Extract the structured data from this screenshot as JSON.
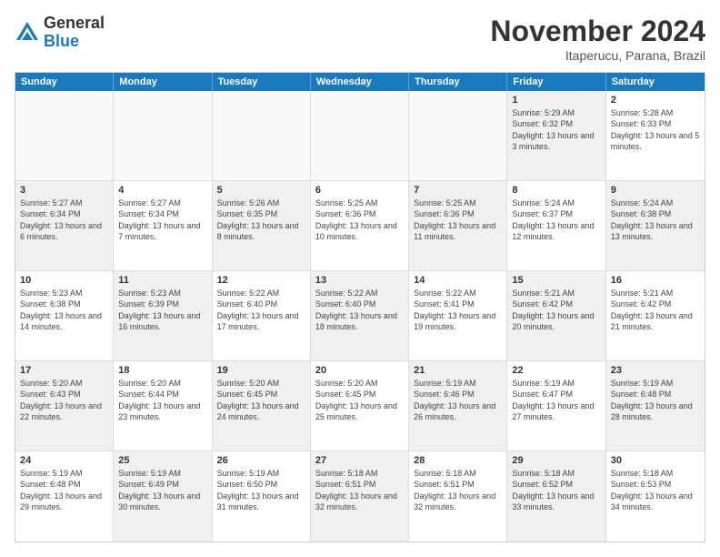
{
  "header": {
    "logo_general": "General",
    "logo_blue": "Blue",
    "month_title": "November 2024",
    "location": "Itaperucu, Parana, Brazil"
  },
  "calendar": {
    "days_of_week": [
      "Sunday",
      "Monday",
      "Tuesday",
      "Wednesday",
      "Thursday",
      "Friday",
      "Saturday"
    ],
    "rows": [
      [
        {
          "day": "",
          "info": "",
          "shaded": false,
          "empty": true
        },
        {
          "day": "",
          "info": "",
          "shaded": false,
          "empty": true
        },
        {
          "day": "",
          "info": "",
          "shaded": false,
          "empty": true
        },
        {
          "day": "",
          "info": "",
          "shaded": false,
          "empty": true
        },
        {
          "day": "",
          "info": "",
          "shaded": false,
          "empty": true
        },
        {
          "day": "1",
          "info": "Sunrise: 5:29 AM\nSunset: 6:32 PM\nDaylight: 13 hours and 3 minutes.",
          "shaded": true,
          "empty": false
        },
        {
          "day": "2",
          "info": "Sunrise: 5:28 AM\nSunset: 6:33 PM\nDaylight: 13 hours and 5 minutes.",
          "shaded": false,
          "empty": false
        }
      ],
      [
        {
          "day": "3",
          "info": "Sunrise: 5:27 AM\nSunset: 6:34 PM\nDaylight: 13 hours and 6 minutes.",
          "shaded": true,
          "empty": false
        },
        {
          "day": "4",
          "info": "Sunrise: 5:27 AM\nSunset: 6:34 PM\nDaylight: 13 hours and 7 minutes.",
          "shaded": false,
          "empty": false
        },
        {
          "day": "5",
          "info": "Sunrise: 5:26 AM\nSunset: 6:35 PM\nDaylight: 13 hours and 8 minutes.",
          "shaded": true,
          "empty": false
        },
        {
          "day": "6",
          "info": "Sunrise: 5:25 AM\nSunset: 6:36 PM\nDaylight: 13 hours and 10 minutes.",
          "shaded": false,
          "empty": false
        },
        {
          "day": "7",
          "info": "Sunrise: 5:25 AM\nSunset: 6:36 PM\nDaylight: 13 hours and 11 minutes.",
          "shaded": true,
          "empty": false
        },
        {
          "day": "8",
          "info": "Sunrise: 5:24 AM\nSunset: 6:37 PM\nDaylight: 13 hours and 12 minutes.",
          "shaded": false,
          "empty": false
        },
        {
          "day": "9",
          "info": "Sunrise: 5:24 AM\nSunset: 6:38 PM\nDaylight: 13 hours and 13 minutes.",
          "shaded": true,
          "empty": false
        }
      ],
      [
        {
          "day": "10",
          "info": "Sunrise: 5:23 AM\nSunset: 6:38 PM\nDaylight: 13 hours and 14 minutes.",
          "shaded": false,
          "empty": false
        },
        {
          "day": "11",
          "info": "Sunrise: 5:23 AM\nSunset: 6:39 PM\nDaylight: 13 hours and 16 minutes.",
          "shaded": true,
          "empty": false
        },
        {
          "day": "12",
          "info": "Sunrise: 5:22 AM\nSunset: 6:40 PM\nDaylight: 13 hours and 17 minutes.",
          "shaded": false,
          "empty": false
        },
        {
          "day": "13",
          "info": "Sunrise: 5:22 AM\nSunset: 6:40 PM\nDaylight: 13 hours and 18 minutes.",
          "shaded": true,
          "empty": false
        },
        {
          "day": "14",
          "info": "Sunrise: 5:22 AM\nSunset: 6:41 PM\nDaylight: 13 hours and 19 minutes.",
          "shaded": false,
          "empty": false
        },
        {
          "day": "15",
          "info": "Sunrise: 5:21 AM\nSunset: 6:42 PM\nDaylight: 13 hours and 20 minutes.",
          "shaded": true,
          "empty": false
        },
        {
          "day": "16",
          "info": "Sunrise: 5:21 AM\nSunset: 6:42 PM\nDaylight: 13 hours and 21 minutes.",
          "shaded": false,
          "empty": false
        }
      ],
      [
        {
          "day": "17",
          "info": "Sunrise: 5:20 AM\nSunset: 6:43 PM\nDaylight: 13 hours and 22 minutes.",
          "shaded": true,
          "empty": false
        },
        {
          "day": "18",
          "info": "Sunrise: 5:20 AM\nSunset: 6:44 PM\nDaylight: 13 hours and 23 minutes.",
          "shaded": false,
          "empty": false
        },
        {
          "day": "19",
          "info": "Sunrise: 5:20 AM\nSunset: 6:45 PM\nDaylight: 13 hours and 24 minutes.",
          "shaded": true,
          "empty": false
        },
        {
          "day": "20",
          "info": "Sunrise: 5:20 AM\nSunset: 6:45 PM\nDaylight: 13 hours and 25 minutes.",
          "shaded": false,
          "empty": false
        },
        {
          "day": "21",
          "info": "Sunrise: 5:19 AM\nSunset: 6:46 PM\nDaylight: 13 hours and 26 minutes.",
          "shaded": true,
          "empty": false
        },
        {
          "day": "22",
          "info": "Sunrise: 5:19 AM\nSunset: 6:47 PM\nDaylight: 13 hours and 27 minutes.",
          "shaded": false,
          "empty": false
        },
        {
          "day": "23",
          "info": "Sunrise: 5:19 AM\nSunset: 6:48 PM\nDaylight: 13 hours and 28 minutes.",
          "shaded": true,
          "empty": false
        }
      ],
      [
        {
          "day": "24",
          "info": "Sunrise: 5:19 AM\nSunset: 6:48 PM\nDaylight: 13 hours and 29 minutes.",
          "shaded": false,
          "empty": false
        },
        {
          "day": "25",
          "info": "Sunrise: 5:19 AM\nSunset: 6:49 PM\nDaylight: 13 hours and 30 minutes.",
          "shaded": true,
          "empty": false
        },
        {
          "day": "26",
          "info": "Sunrise: 5:19 AM\nSunset: 6:50 PM\nDaylight: 13 hours and 31 minutes.",
          "shaded": false,
          "empty": false
        },
        {
          "day": "27",
          "info": "Sunrise: 5:18 AM\nSunset: 6:51 PM\nDaylight: 13 hours and 32 minutes.",
          "shaded": true,
          "empty": false
        },
        {
          "day": "28",
          "info": "Sunrise: 5:18 AM\nSunset: 6:51 PM\nDaylight: 13 hours and 32 minutes.",
          "shaded": false,
          "empty": false
        },
        {
          "day": "29",
          "info": "Sunrise: 5:18 AM\nSunset: 6:52 PM\nDaylight: 13 hours and 33 minutes.",
          "shaded": true,
          "empty": false
        },
        {
          "day": "30",
          "info": "Sunrise: 5:18 AM\nSunset: 6:53 PM\nDaylight: 13 hours and 34 minutes.",
          "shaded": false,
          "empty": false
        }
      ]
    ]
  }
}
